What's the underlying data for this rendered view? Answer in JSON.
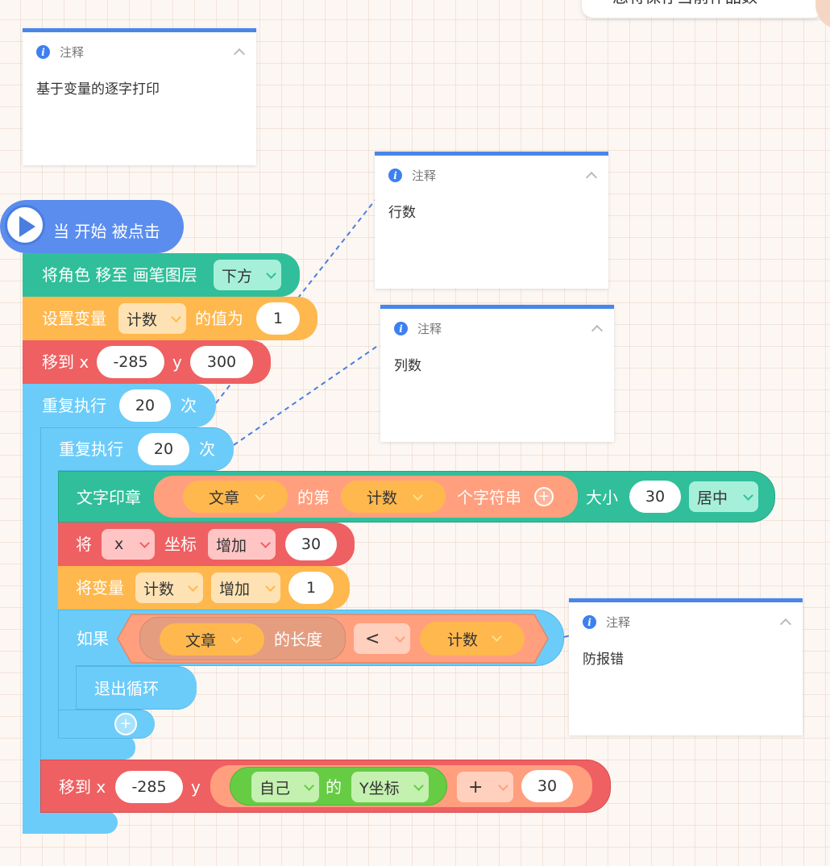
{
  "hat": {
    "label": "当 开始 被点击"
  },
  "layer": {
    "label": "将角色 移至 画笔图层",
    "option": "下方"
  },
  "set_var": {
    "label": "设置变量",
    "var": "计数",
    "label2": "的值为",
    "value": "1"
  },
  "move1": {
    "label": "移到 x",
    "x": "-285",
    "ylabel": "y",
    "y": "300"
  },
  "repeat_outer": {
    "label": "重复执行",
    "count": "20",
    "suffix": "次"
  },
  "repeat_inner": {
    "label": "重复执行",
    "count": "20",
    "suffix": "次"
  },
  "stamp": {
    "label": "文字印章",
    "var": "文章",
    "of": "的第",
    "index": "计数",
    "chars": "个字符串",
    "size_label": "大小",
    "size": "30",
    "align": "居中"
  },
  "change_coord": {
    "label": "将",
    "axis": "x",
    "label2": "坐标",
    "op": "增加",
    "value": "30"
  },
  "change_var": {
    "label": "将变量",
    "var": "计数",
    "op": "增加",
    "value": "1"
  },
  "if_block": {
    "label": "如果",
    "var": "文章",
    "length": "的长度",
    "op": "<",
    "var2": "计数"
  },
  "break": {
    "label": "退出循环"
  },
  "plus": "+",
  "move2": {
    "label": "移到 x",
    "x": "-285",
    "ylabel": "y",
    "obj": "自己",
    "of": "的",
    "attr": "Y坐标",
    "op": "+",
    "value": "30"
  },
  "notes": [
    {
      "title": "注释",
      "body": "基于变量的逐字打印"
    },
    {
      "title": "注释",
      "body": "行数"
    },
    {
      "title": "注释",
      "body": "列数"
    },
    {
      "title": "注释",
      "body": "防报错"
    }
  ],
  "top_banner": "您将保存当前作品数",
  "colors": {
    "hat": "#5b8def",
    "teal": "#30bf9a",
    "orange": "#ffb84d",
    "red": "#ef6062",
    "control": "#6cccf9",
    "green": "#66cc44",
    "salmon": "#ff9f7e"
  }
}
